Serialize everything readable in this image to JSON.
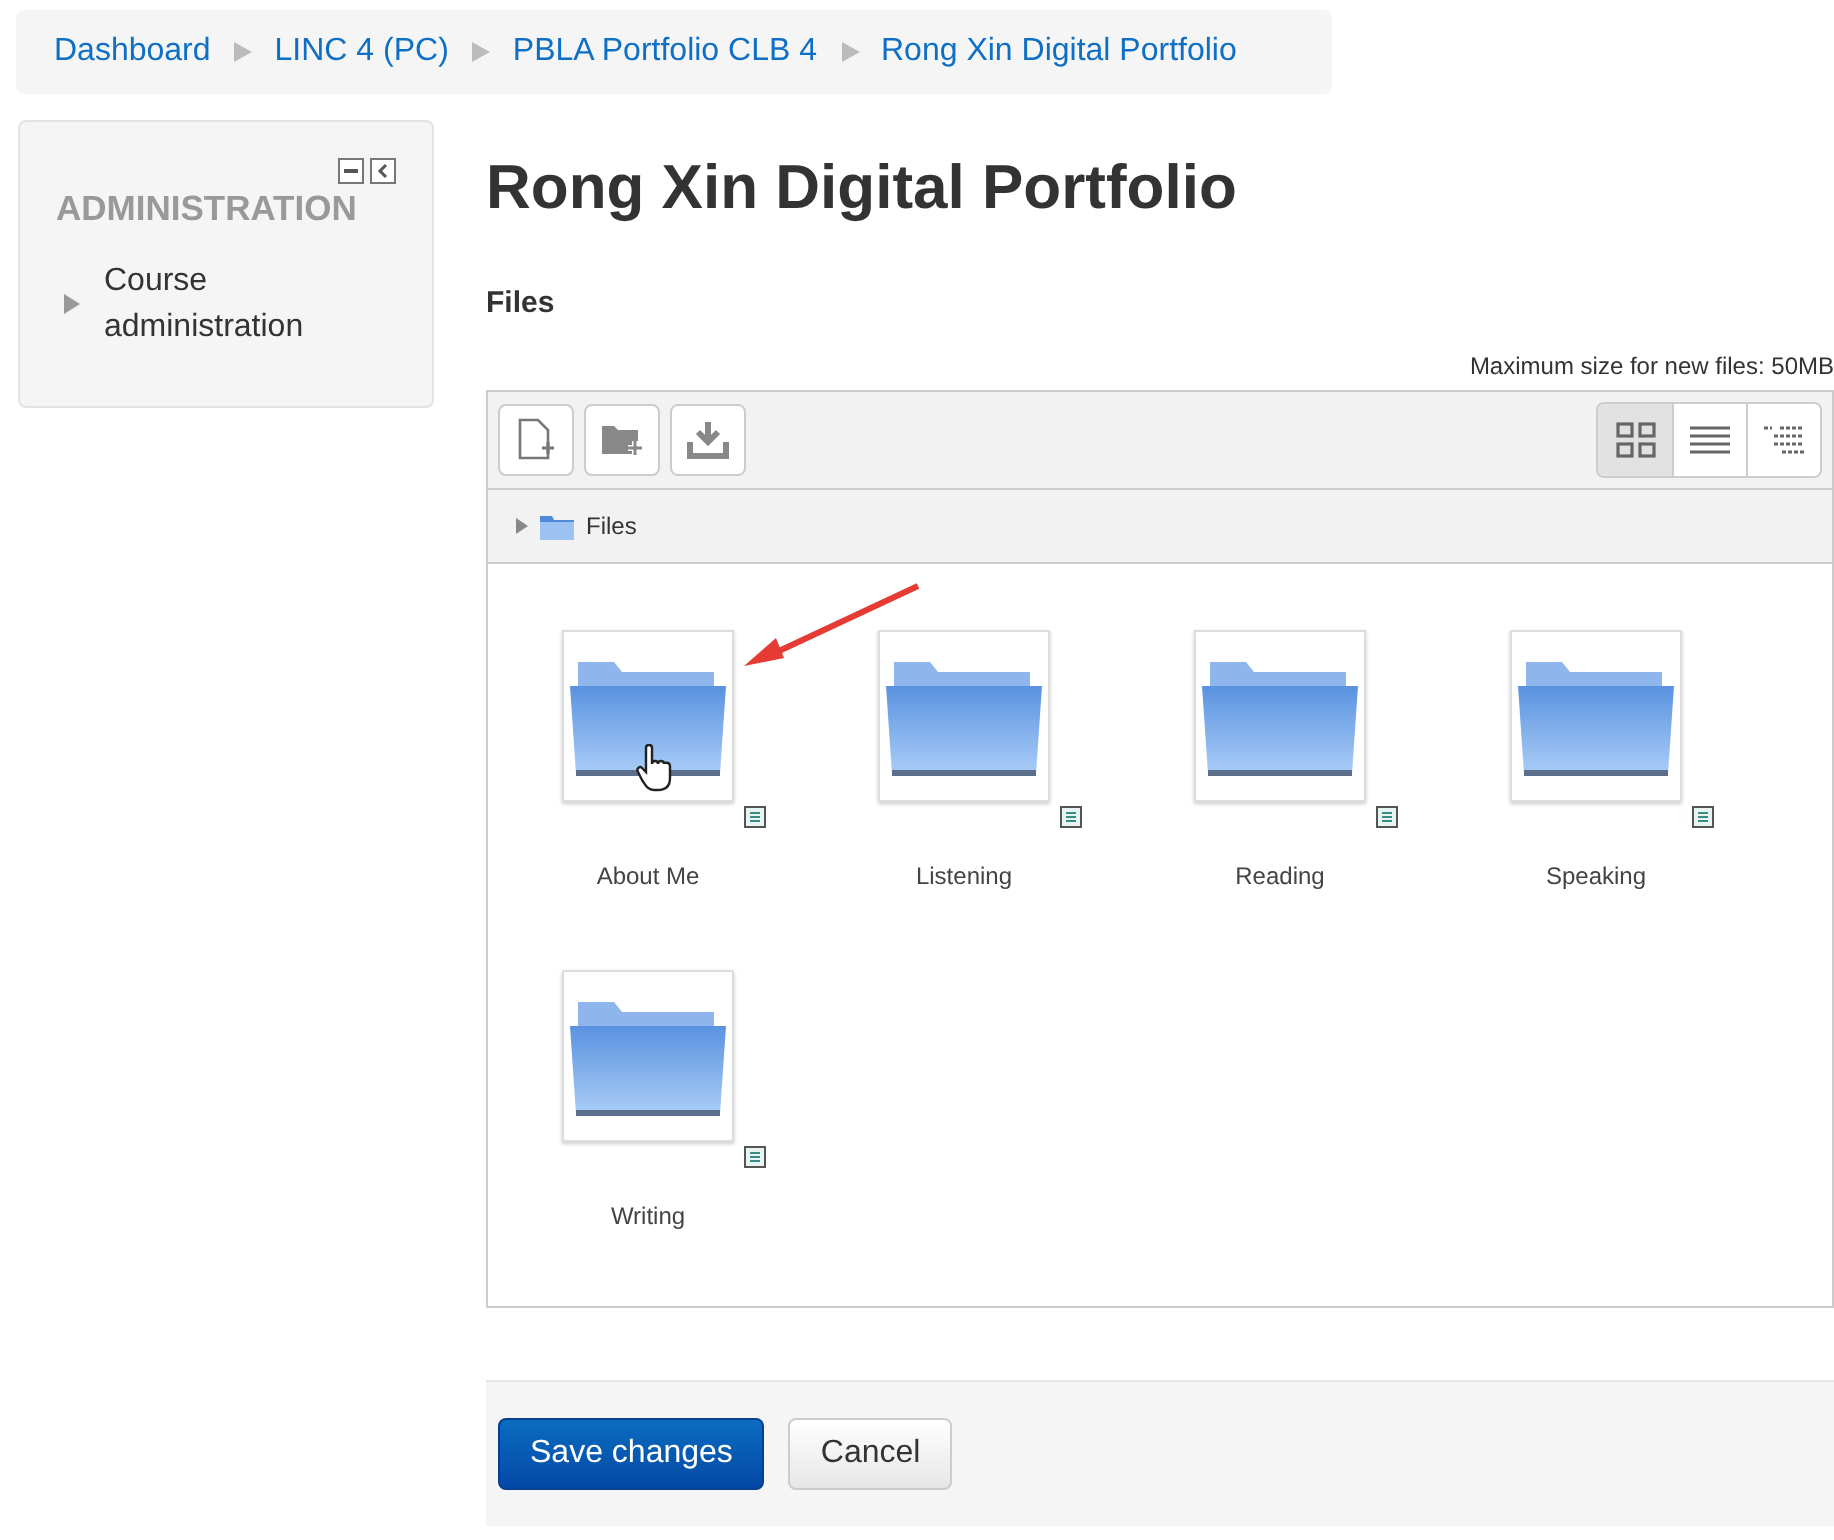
{
  "breadcrumb": [
    "Dashboard",
    "LINC 4 (PC)",
    "PBLA Portfolio CLB 4",
    "Rong Xin Digital Portfolio"
  ],
  "sidebar": {
    "title": "ADMINISTRATION",
    "items": [
      {
        "label": "Course administration",
        "expanded": false
      }
    ]
  },
  "page_title": "Rong Xin Digital Portfolio",
  "files_label": "Files",
  "max_size": "Maximum size for new files: 50MB",
  "toolbar": {
    "actions": [
      {
        "kind": "add-file"
      },
      {
        "kind": "add-folder"
      },
      {
        "kind": "download"
      }
    ],
    "view_modes": [
      {
        "kind": "icons",
        "selected": true
      },
      {
        "kind": "list",
        "selected": false
      },
      {
        "kind": "tree",
        "selected": false
      }
    ]
  },
  "path": "Files",
  "folders": [
    {
      "name": "About Me",
      "pointed": true
    },
    {
      "name": "Listening",
      "pointed": false
    },
    {
      "name": "Reading",
      "pointed": false
    },
    {
      "name": "Speaking",
      "pointed": false
    },
    {
      "name": "Writing",
      "pointed": false
    }
  ],
  "buttons": [
    {
      "label": "Save changes",
      "kind": "primary"
    },
    {
      "label": "Cancel",
      "kind": "secondary"
    }
  ]
}
